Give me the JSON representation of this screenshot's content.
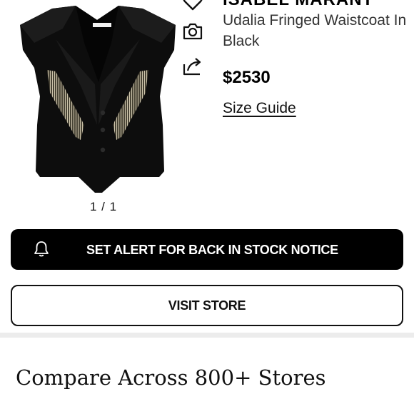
{
  "product": {
    "brand": "ISABEL MARANT",
    "name": "Udalia Fringed Waistcoat In Black",
    "price": "$2530",
    "size_guide_label": "Size Guide",
    "image_pager": "1 / 1",
    "image_brand_tag": "ISABEL MARANT"
  },
  "side_actions": {
    "icons": [
      "heart-icon",
      "camera-icon",
      "share-icon"
    ]
  },
  "actions": {
    "alert_label": "SET ALERT FOR BACK IN STOCK NOTICE",
    "alert_icon": "bell-icon",
    "visit_store_label": "VISIT STORE"
  },
  "compare": {
    "title": "Compare Across 800+ Stores"
  },
  "colors": {
    "primary": "#000000",
    "background": "#ffffff",
    "divider": "#ececec",
    "fringe": "#c9bfa6"
  }
}
